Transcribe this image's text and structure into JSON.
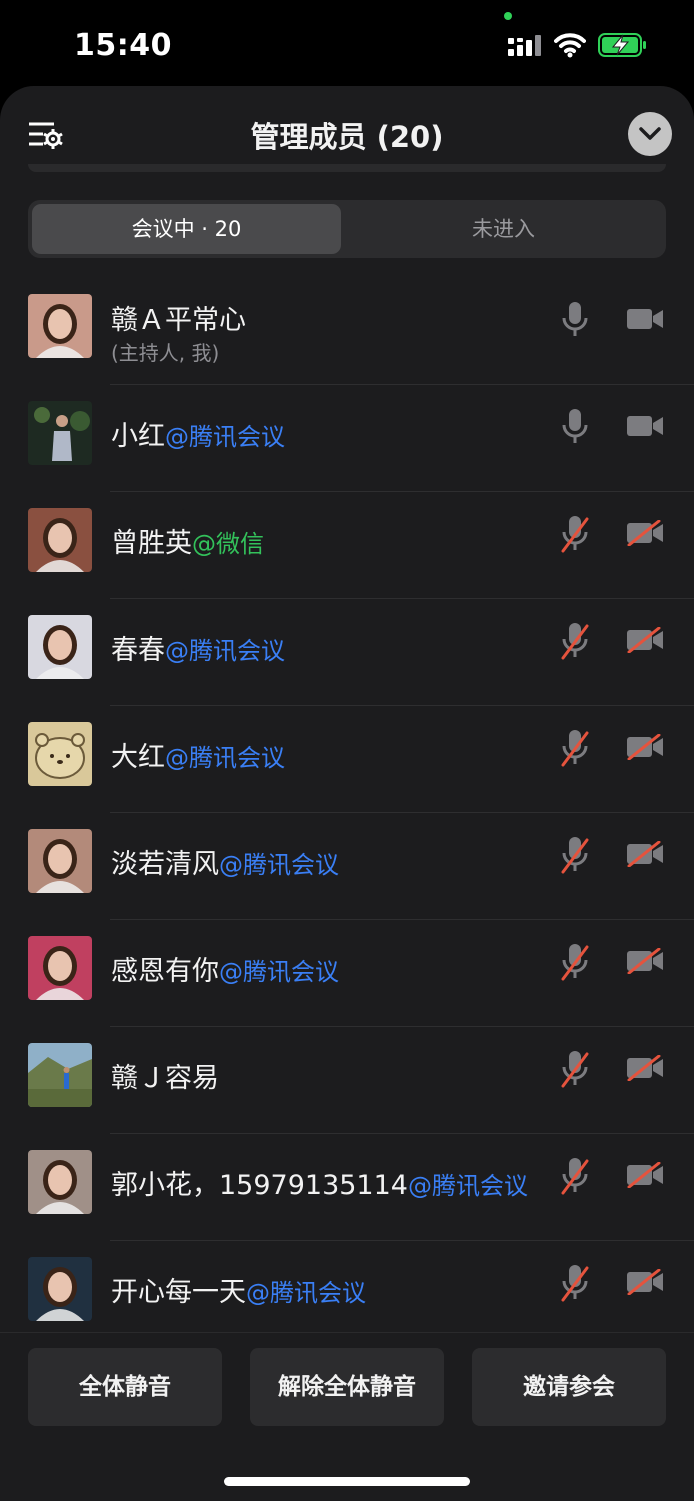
{
  "status_bar": {
    "time": "15:40"
  },
  "header": {
    "title": "管理成员 (20)"
  },
  "tabs": [
    {
      "label": "会议中 · 20",
      "active": true
    },
    {
      "label": "未进入",
      "active": false
    }
  ],
  "members": [
    {
      "name": "赣Ａ平常心",
      "suffix": "",
      "suffix_color": "",
      "role": "(主持人, 我)",
      "mic": "on",
      "camera": "on",
      "avatar_icon": "woman-portrait-avatar"
    },
    {
      "name": "小红",
      "suffix": "@腾讯会议",
      "suffix_color": "blue",
      "role": "",
      "mic": "on",
      "camera": "on",
      "avatar_icon": "night-photo-avatar"
    },
    {
      "name": "曾胜英",
      "suffix": "@微信",
      "suffix_color": "green",
      "role": "",
      "mic": "off",
      "camera": "off",
      "avatar_icon": "woman-portrait-avatar"
    },
    {
      "name": "春春",
      "suffix": "@腾讯会议",
      "suffix_color": "blue",
      "role": "",
      "mic": "off",
      "camera": "off",
      "avatar_icon": "woman-portrait-avatar"
    },
    {
      "name": "大红",
      "suffix": "@腾讯会议",
      "suffix_color": "blue",
      "role": "",
      "mic": "off",
      "camera": "off",
      "avatar_icon": "cartoon-bear-avatar"
    },
    {
      "name": "淡若清风",
      "suffix": "@腾讯会议",
      "suffix_color": "blue",
      "role": "",
      "mic": "off",
      "camera": "off",
      "avatar_icon": "woman-portrait-avatar"
    },
    {
      "name": "感恩有你",
      "suffix": "@腾讯会议",
      "suffix_color": "blue",
      "role": "",
      "mic": "off",
      "camera": "off",
      "avatar_icon": "woman-portrait-avatar"
    },
    {
      "name": "赣Ｊ容易",
      "suffix": "",
      "suffix_color": "",
      "role": "",
      "mic": "off",
      "camera": "off",
      "avatar_icon": "landscape-avatar"
    },
    {
      "name": "郭小花，15979135114",
      "suffix": "@腾讯会议",
      "suffix_color": "blue",
      "role": "",
      "mic": "off",
      "camera": "off",
      "avatar_icon": "woman-portrait-avatar"
    },
    {
      "name": "开心每一天",
      "suffix": "@腾讯会议",
      "suffix_color": "blue",
      "role": "",
      "mic": "off",
      "camera": "off",
      "avatar_icon": "woman-portrait-avatar"
    }
  ],
  "actions": {
    "mute_all": "全体静音",
    "unmute_all": "解除全体静音",
    "invite": "邀请参会"
  },
  "colors": {
    "background": "#1c1c1e",
    "link_blue": "#3a7ff5",
    "wechat_green": "#33c25b",
    "muted_red": "#e5533d",
    "battery_green": "#30d158"
  }
}
